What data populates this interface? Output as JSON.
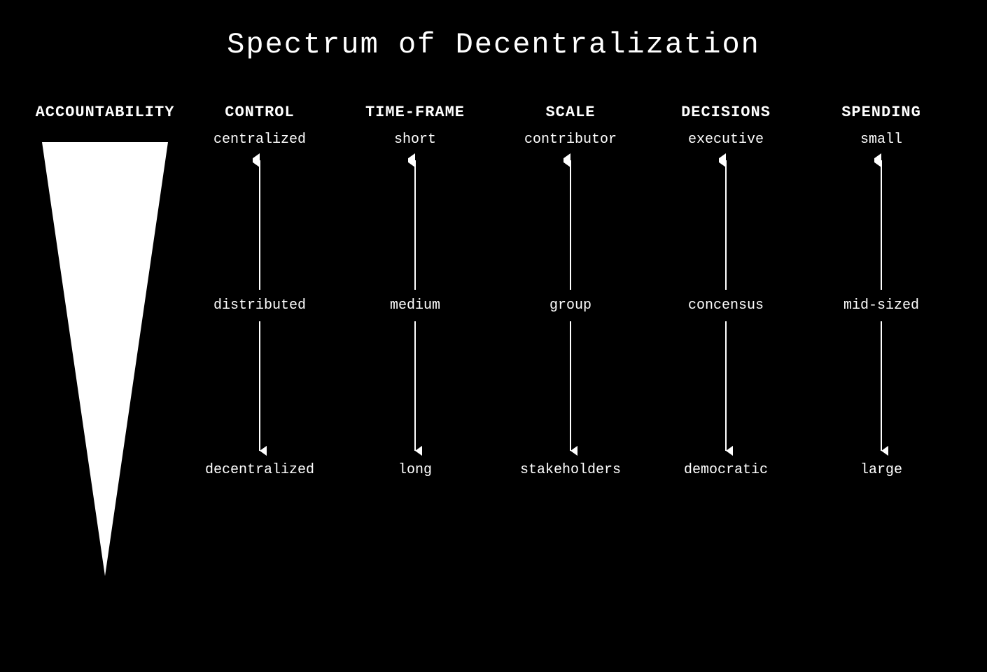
{
  "title": "Spectrum of Decentralization",
  "accountability": {
    "header": "ACCOUNTABILITY"
  },
  "columns": [
    {
      "id": "control",
      "header": "CONTROL",
      "top": "centralized",
      "mid": "distributed",
      "bottom": "decentralized"
    },
    {
      "id": "timeframe",
      "header": "TIME-FRAME",
      "top": "short",
      "mid": "medium",
      "bottom": "long"
    },
    {
      "id": "scale",
      "header": "SCALE",
      "top": "contributor",
      "mid": "group",
      "bottom": "stakeholders"
    },
    {
      "id": "decisions",
      "header": "DECISIONS",
      "top": "executive",
      "mid": "concensus",
      "bottom": "democratic"
    },
    {
      "id": "spending",
      "header": "SPENDING",
      "top": "small",
      "mid": "mid-sized",
      "bottom": "large"
    }
  ]
}
